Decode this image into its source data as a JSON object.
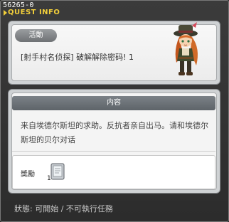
{
  "window": {
    "quest_id": "56265-0",
    "title": "QUEST INFO"
  },
  "quest": {
    "type_badge": "活動",
    "name": "[射手村名侦探] 破解解除密码! 1"
  },
  "content": {
    "section_label": "内容",
    "description": "来自埃德尔斯坦的求助。反抗者亲自出马。请和埃德尔斯坦的贝尔对话"
  },
  "reward": {
    "label": "獎勵",
    "item_icon": "tablet-item-icon",
    "item_count": "1"
  },
  "status_text": "狀態: 可開始 / 不可執行任務",
  "colors": {
    "title_yellow": "#f2cf3a",
    "section_header": "#6c7278"
  }
}
